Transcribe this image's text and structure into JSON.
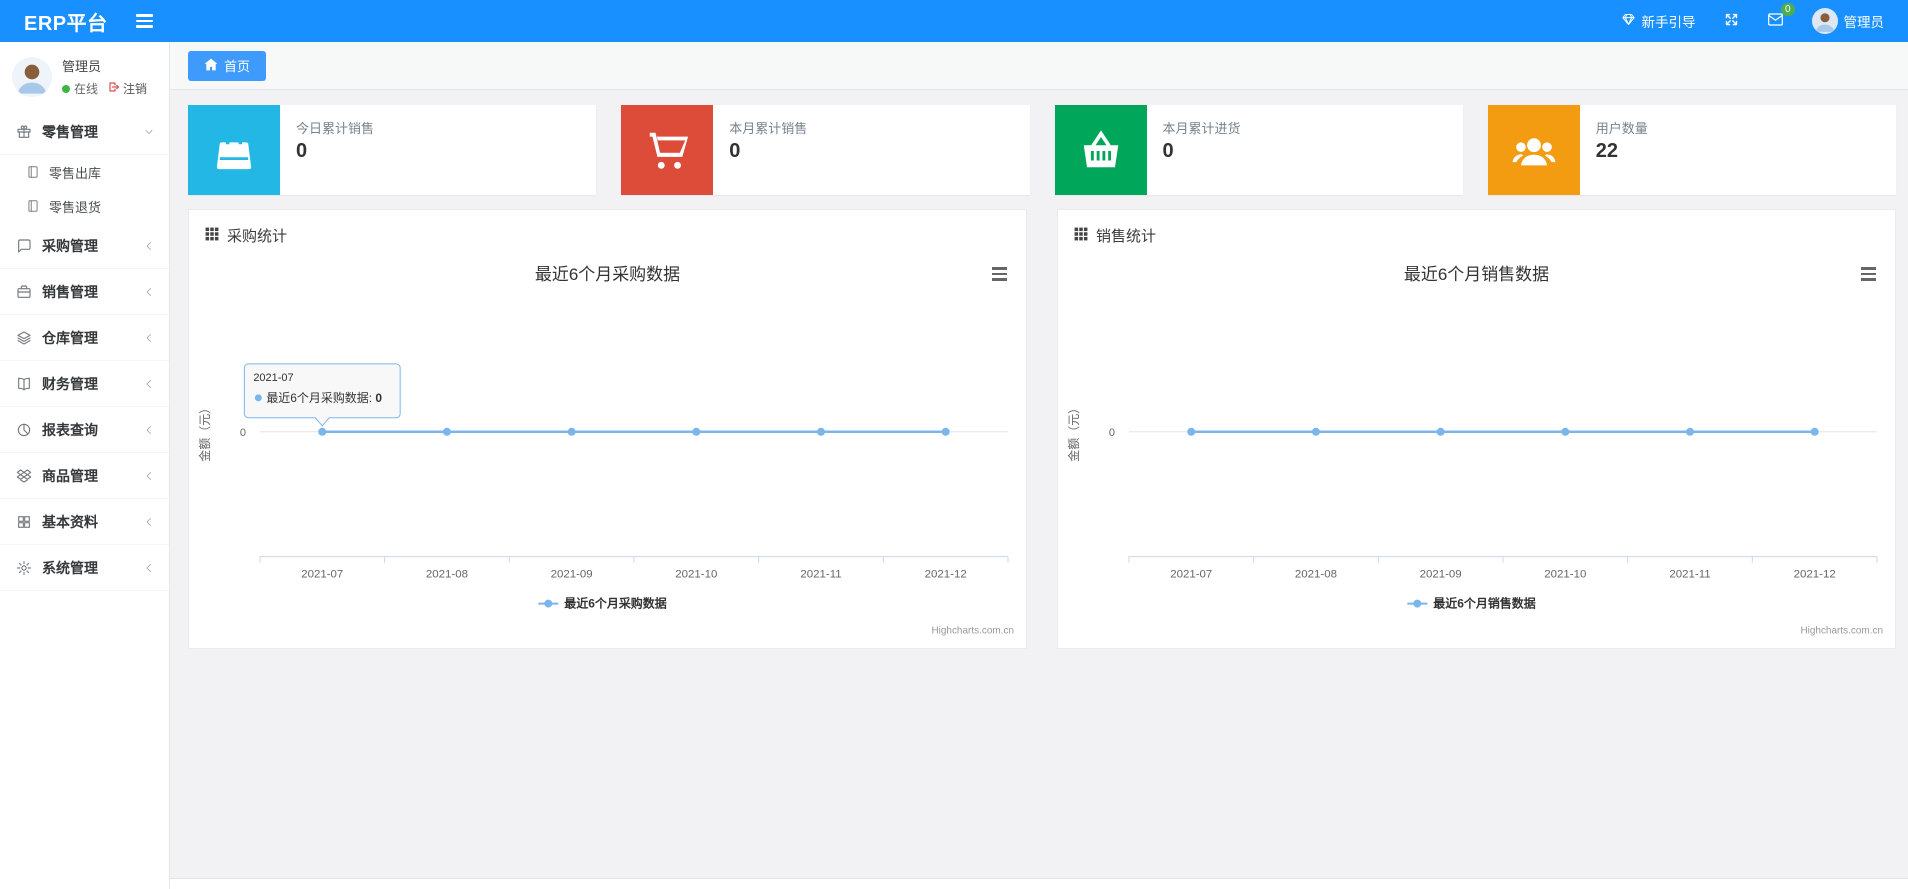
{
  "topbar": {
    "brand": "ERP平台",
    "guide_label": "新手引导",
    "mail_badge": "0",
    "username": "管理员"
  },
  "sidebar": {
    "user": {
      "name": "管理员",
      "status": "在线",
      "logout": "注销"
    },
    "menu": [
      {
        "label": "零售管理",
        "icon": "gift-icon",
        "expanded": true,
        "children": [
          {
            "label": "零售出库",
            "icon": "journal-icon"
          },
          {
            "label": "零售退货",
            "icon": "journal-icon"
          }
        ]
      },
      {
        "label": "采购管理",
        "icon": "message-square-icon"
      },
      {
        "label": "销售管理",
        "icon": "briefcase-icon"
      },
      {
        "label": "仓库管理",
        "icon": "layers-icon"
      },
      {
        "label": "财务管理",
        "icon": "book-open-icon"
      },
      {
        "label": "报表查询",
        "icon": "pie-chart-icon"
      },
      {
        "label": "商品管理",
        "icon": "dropbox-icon"
      },
      {
        "label": "基本资料",
        "icon": "grid-icon"
      },
      {
        "label": "系统管理",
        "icon": "gear-icon"
      }
    ]
  },
  "tabbar": {
    "home_tab": "首页"
  },
  "cards": [
    {
      "label": "今日累计销售",
      "value": "0",
      "color": "#23b7e5",
      "icon": "shopping-bag-icon"
    },
    {
      "label": "本月累计销售",
      "value": "0",
      "color": "#dd4b39",
      "icon": "shopping-cart-icon"
    },
    {
      "label": "本月累计进货",
      "value": "0",
      "color": "#00a65a",
      "icon": "shopping-basket-icon"
    },
    {
      "label": "用户数量",
      "value": "22",
      "color": "#f39c12",
      "icon": "users-icon"
    }
  ],
  "panels": [
    {
      "header": "采购统计"
    },
    {
      "header": "销售统计"
    }
  ],
  "chart_data": [
    {
      "type": "line",
      "title": "最近6个月采购数据",
      "categories": [
        "2021-07",
        "2021-08",
        "2021-09",
        "2021-10",
        "2021-11",
        "2021-12"
      ],
      "series": [
        {
          "name": "最近6个月采购数据",
          "values": [
            0,
            0,
            0,
            0,
            0,
            0
          ],
          "color": "#7cb5ec"
        }
      ],
      "xlabel": "",
      "ylabel": "金额（元）",
      "ylim": [
        -1,
        1
      ],
      "yticks": [
        0
      ],
      "grid": true,
      "legend_position": "bottom",
      "credits": "Highcharts.com.cn",
      "tooltip": {
        "pointIndex": 0,
        "title": "2021-07",
        "label": "最近6个月采购数据",
        "value": "0"
      }
    },
    {
      "type": "line",
      "title": "最近6个月销售数据",
      "categories": [
        "2021-07",
        "2021-08",
        "2021-09",
        "2021-10",
        "2021-11",
        "2021-12"
      ],
      "series": [
        {
          "name": "最近6个月销售数据",
          "values": [
            0,
            0,
            0,
            0,
            0,
            0
          ],
          "color": "#7cb5ec"
        }
      ],
      "xlabel": "",
      "ylabel": "金额（元）",
      "ylim": [
        -1,
        1
      ],
      "yticks": [
        0
      ],
      "grid": true,
      "legend_position": "bottom",
      "credits": "Highcharts.com.cn"
    }
  ]
}
